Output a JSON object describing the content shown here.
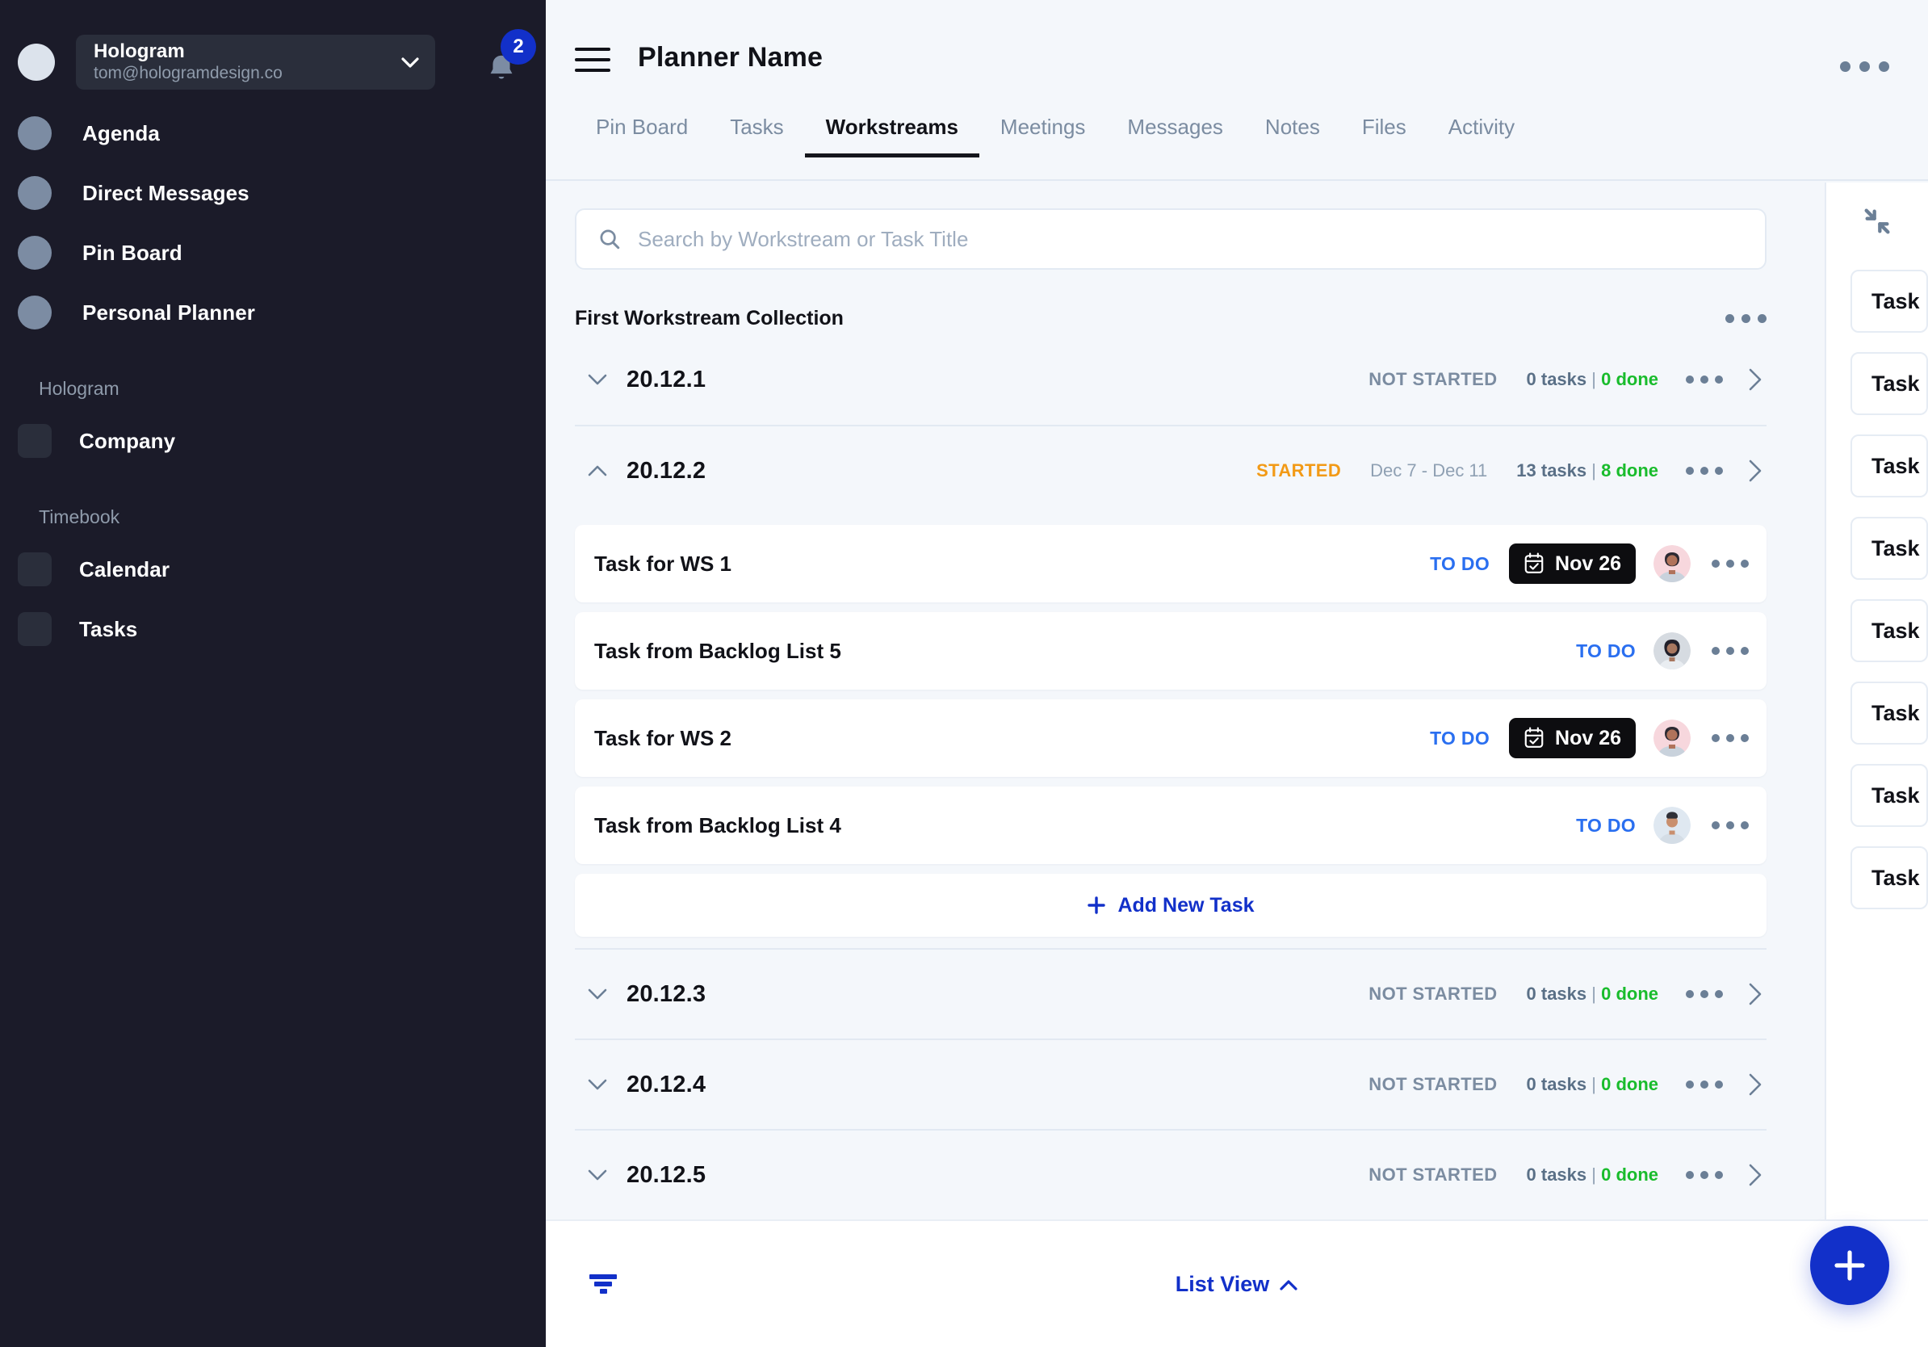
{
  "sidebar": {
    "org": {
      "name": "Hologram",
      "email": "tom@hologramdesign.co",
      "chevron_icon": "chevron-down-icon"
    },
    "notifications": {
      "count": "2",
      "icon": "bell-icon"
    },
    "nav_items": [
      {
        "label": "Agenda",
        "icon": "circle-icon"
      },
      {
        "label": "Direct Messages",
        "icon": "circle-icon"
      },
      {
        "label": "Pin Board",
        "icon": "circle-icon"
      },
      {
        "label": "Personal Planner",
        "icon": "circle-icon"
      }
    ],
    "groups": [
      {
        "title": "Hologram",
        "items": [
          {
            "label": "Company",
            "icon": "square-icon"
          }
        ]
      },
      {
        "title": "Timebook",
        "items": [
          {
            "label": "Calendar",
            "icon": "square-icon"
          },
          {
            "label": "Tasks",
            "icon": "square-icon"
          }
        ]
      }
    ]
  },
  "header": {
    "menu_icon": "hamburger-icon",
    "title": "Planner Name",
    "overflow_icon": "more-horizontal-icon"
  },
  "tabs": [
    {
      "label": "Pin Board",
      "active": false
    },
    {
      "label": "Tasks",
      "active": false
    },
    {
      "label": "Workstreams",
      "active": true
    },
    {
      "label": "Meetings",
      "active": false
    },
    {
      "label": "Messages",
      "active": false
    },
    {
      "label": "Notes",
      "active": false
    },
    {
      "label": "Files",
      "active": false
    },
    {
      "label": "Activity",
      "active": false
    }
  ],
  "search": {
    "placeholder": "Search by Workstream or Task Title",
    "value": "",
    "icon": "search-icon"
  },
  "collection": {
    "title": "First Workstream Collection",
    "overflow_icon": "more-horizontal-icon"
  },
  "workstreams": [
    {
      "name": "20.12.1",
      "status": "NOT STARTED",
      "status_kind": "not-started",
      "dates": "",
      "tasks_count": "0 tasks",
      "separator": " | ",
      "done_count": "0 done",
      "expanded": false,
      "caret_icon": "chevron-down-icon"
    },
    {
      "name": "20.12.2",
      "status": "STARTED",
      "status_kind": "started",
      "dates": "Dec 7 - Dec 11",
      "tasks_count": "13 tasks",
      "separator": " | ",
      "done_count": "8 done",
      "expanded": true,
      "caret_icon": "chevron-up-icon"
    },
    {
      "name": "20.12.3",
      "status": "NOT STARTED",
      "status_kind": "not-started",
      "dates": "",
      "tasks_count": "0 tasks",
      "separator": " | ",
      "done_count": "0 done",
      "expanded": false,
      "caret_icon": "chevron-down-icon"
    },
    {
      "name": "20.12.4",
      "status": "NOT STARTED",
      "status_kind": "not-started",
      "dates": "",
      "tasks_count": "0 tasks",
      "separator": " | ",
      "done_count": "0 done",
      "expanded": false,
      "caret_icon": "chevron-down-icon"
    },
    {
      "name": "20.12.5",
      "status": "NOT STARTED",
      "status_kind": "not-started",
      "dates": "",
      "tasks_count": "0 tasks",
      "separator": " | ",
      "done_count": "0 done",
      "expanded": false,
      "caret_icon": "chevron-down-icon"
    }
  ],
  "tasks": [
    {
      "title": "Task for WS 1",
      "status": "TO DO",
      "due_date": "Nov 26",
      "has_due_date": true,
      "date_icon": "calendar-check-icon",
      "avatar": "avatar-pink",
      "overflow_icon": "more-horizontal-icon"
    },
    {
      "title": "Task from Backlog List 5",
      "status": "TO DO",
      "due_date": "",
      "has_due_date": false,
      "date_icon": "calendar-check-icon",
      "avatar": "avatar-grey",
      "overflow_icon": "more-horizontal-icon"
    },
    {
      "title": "Task for WS 2",
      "status": "TO DO",
      "due_date": "Nov 26",
      "has_due_date": true,
      "date_icon": "calendar-check-icon",
      "avatar": "avatar-pink",
      "overflow_icon": "more-horizontal-icon"
    },
    {
      "title": "Task from Backlog List 4",
      "status": "TO DO",
      "due_date": "",
      "has_due_date": false,
      "date_icon": "calendar-check-icon",
      "avatar": "avatar-blue",
      "overflow_icon": "more-horizontal-icon"
    }
  ],
  "add_task": {
    "label": "Add New Task",
    "icon": "plus-icon"
  },
  "bottom_bar": {
    "filter_icon": "filter-icon",
    "view_label": "List View",
    "view_caret_icon": "chevron-up-icon"
  },
  "fab": {
    "icon": "plus-icon"
  },
  "right_panel": {
    "collapse_icon": "collapse-inward-icon",
    "cards": [
      {
        "label": "Task"
      },
      {
        "label": "Task"
      },
      {
        "label": "Task"
      },
      {
        "label": "Task"
      },
      {
        "label": "Task"
      },
      {
        "label": "Task"
      },
      {
        "label": "Task"
      },
      {
        "label": "Task"
      }
    ]
  },
  "colors": {
    "accent_blue": "#1230c9",
    "status_blue": "#2a6ff0",
    "status_orange": "#f29a16",
    "done_green": "#19bc2c",
    "sidebar_bg": "#1b1b29",
    "main_bg": "#f4f7fb",
    "muted_text": "#7b8ca1"
  }
}
